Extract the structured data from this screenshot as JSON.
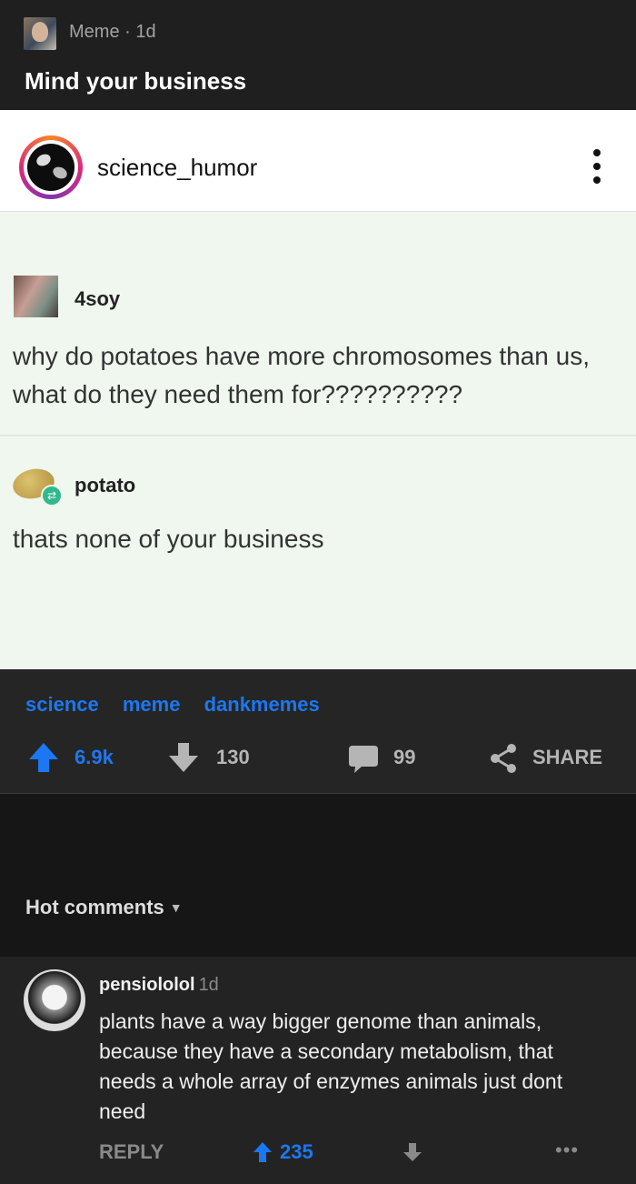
{
  "post": {
    "section": "Meme",
    "age": "1d",
    "title": "Mind your business"
  },
  "instagram": {
    "username": "science_humor"
  },
  "tumblr": {
    "user1": "4soy",
    "text1": "why do potatoes have more chromosomes than us, what do they need them for??????????",
    "user2": "potato",
    "text2": "thats none of your business"
  },
  "tags": [
    "science",
    "meme",
    "dankmemes"
  ],
  "actions": {
    "upvotes": "6.9k",
    "downvotes": "130",
    "comments": "99",
    "share": "SHARE"
  },
  "comments_header": "Hot comments",
  "comment": {
    "username": "pensiololol",
    "age": "1d",
    "text": "plants have a way bigger genome than animals, because they have a secondary metabolism, that needs a whole array of enzymes animals just dont need",
    "reply_label": "REPLY",
    "upvotes": "235"
  },
  "colors": {
    "accent": "#1b78f2",
    "background": "#161616",
    "tumblr_bg": "#eff7ef"
  }
}
